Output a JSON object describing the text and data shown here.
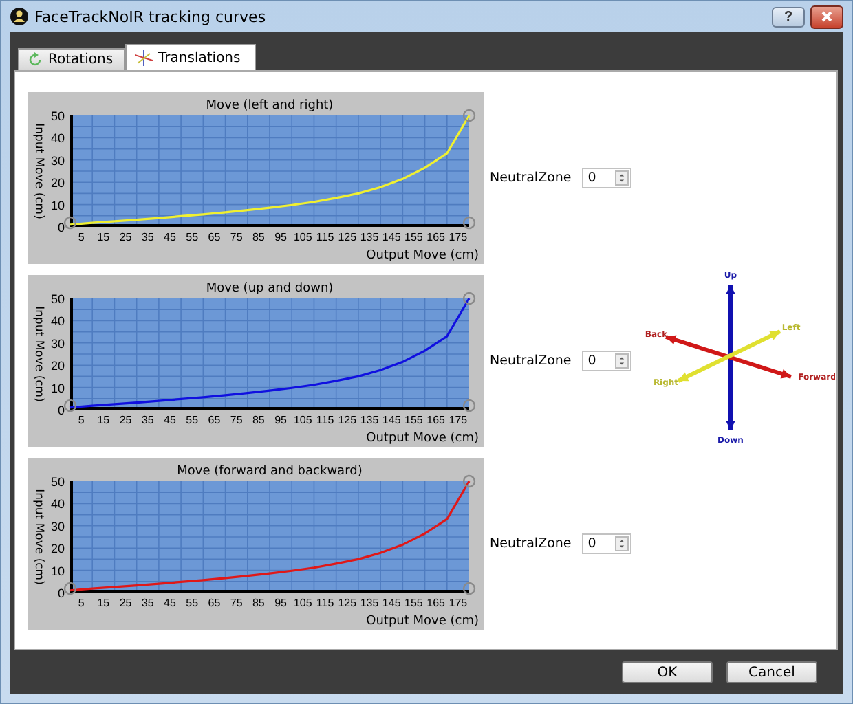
{
  "window": {
    "title": "FaceTrackNoIR tracking curves",
    "help_button": "?"
  },
  "tabs": [
    {
      "label": "Rotations",
      "selected": false
    },
    {
      "label": "Translations",
      "selected": true
    }
  ],
  "curves": [
    {
      "chart_data": {
        "type": "line",
        "title": "Move (left and right)",
        "xlabel": "Output Move (cm)",
        "ylabel": "Input Move (cm)",
        "x": [
          0,
          10,
          20,
          30,
          40,
          50,
          60,
          70,
          80,
          90,
          100,
          110,
          120,
          130,
          140,
          150,
          160,
          170,
          180
        ],
        "series": [
          {
            "color": "#f0f030",
            "values": [
              1,
              1.8,
              2.5,
              3.2,
              4,
              4.8,
              5.6,
              6.5,
              7.5,
              8.6,
              9.8,
              11.2,
              13,
              15,
              17.8,
              21.5,
              26.5,
              33,
              50
            ]
          }
        ],
        "xlim": [
          0,
          180
        ],
        "ylim": [
          0,
          50
        ],
        "xticks": [
          5,
          15,
          25,
          35,
          45,
          55,
          65,
          75,
          85,
          95,
          105,
          115,
          125,
          135,
          145,
          155,
          165,
          175
        ],
        "yticks": [
          0,
          10,
          20,
          30,
          40,
          50
        ],
        "grid": true
      },
      "neutral_zone": {
        "label": "NeutralZone",
        "value": "0"
      }
    },
    {
      "chart_data": {
        "type": "line",
        "title": "Move (up and down)",
        "xlabel": "Output Move (cm)",
        "ylabel": "Input Move (cm)",
        "x": [
          0,
          10,
          20,
          30,
          40,
          50,
          60,
          70,
          80,
          90,
          100,
          110,
          120,
          130,
          140,
          150,
          160,
          170,
          180
        ],
        "series": [
          {
            "color": "#1010e0",
            "values": [
              1,
              1.8,
              2.5,
              3.2,
              4,
              4.8,
              5.6,
              6.5,
              7.5,
              8.6,
              9.8,
              11.2,
              13,
              15,
              17.8,
              21.5,
              26.5,
              33,
              50
            ]
          }
        ],
        "xlim": [
          0,
          180
        ],
        "ylim": [
          0,
          50
        ],
        "xticks": [
          5,
          15,
          25,
          35,
          45,
          55,
          65,
          75,
          85,
          95,
          105,
          115,
          125,
          135,
          145,
          155,
          165,
          175
        ],
        "yticks": [
          0,
          10,
          20,
          30,
          40,
          50
        ],
        "grid": true
      },
      "neutral_zone": {
        "label": "NeutralZone",
        "value": "0"
      }
    },
    {
      "chart_data": {
        "type": "line",
        "title": "Move (forward and backward)",
        "xlabel": "Output Move (cm)",
        "ylabel": "Input Move (cm)",
        "x": [
          0,
          10,
          20,
          30,
          40,
          50,
          60,
          70,
          80,
          90,
          100,
          110,
          120,
          130,
          140,
          150,
          160,
          170,
          180
        ],
        "series": [
          {
            "color": "#e01818",
            "values": [
              1,
              1.8,
              2.5,
              3.2,
              4,
              4.8,
              5.6,
              6.5,
              7.5,
              8.6,
              9.8,
              11.2,
              13,
              15,
              17.8,
              21.5,
              26.5,
              33,
              50
            ]
          }
        ],
        "xlim": [
          0,
          180
        ],
        "ylim": [
          0,
          50
        ],
        "xticks": [
          5,
          15,
          25,
          35,
          45,
          55,
          65,
          75,
          85,
          95,
          105,
          115,
          125,
          135,
          145,
          155,
          165,
          175
        ],
        "yticks": [
          0,
          10,
          20,
          30,
          40,
          50
        ],
        "grid": true
      },
      "neutral_zone": {
        "label": "NeutralZone",
        "value": "0"
      }
    }
  ],
  "axes_diagram": {
    "labels": [
      "Up",
      "Down",
      "Back",
      "Forward",
      "Left",
      "Right"
    ]
  },
  "buttons": [
    "OK",
    "Cancel"
  ]
}
